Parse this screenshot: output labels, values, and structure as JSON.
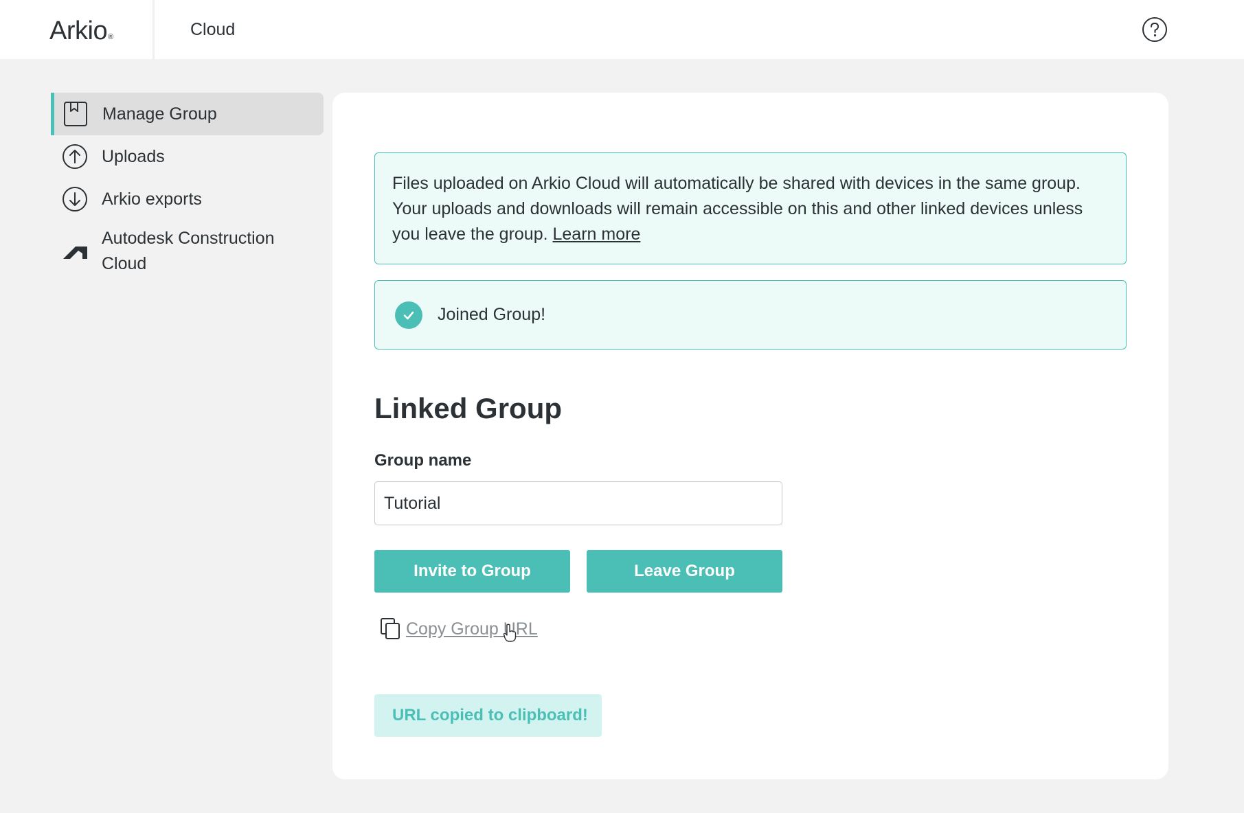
{
  "header": {
    "logo": "Arkio",
    "logo_mark": "®",
    "title": "Cloud",
    "help_icon": "help-circle-icon"
  },
  "sidebar": {
    "items": [
      {
        "label": "Manage Group",
        "icon": "bookmark-page-icon",
        "active": true
      },
      {
        "label": "Uploads",
        "icon": "upload-circle-icon",
        "active": false
      },
      {
        "label": "Arkio exports",
        "icon": "download-circle-icon",
        "active": false
      },
      {
        "label": "Autodesk Construction Cloud",
        "icon": "autodesk-logo-icon",
        "active": false
      }
    ]
  },
  "main": {
    "notice": {
      "text": "Files uploaded on Arkio Cloud will automatically be shared with devices in the same group. Your uploads and downloads will remain accessible on this and other linked devices unless you leave the group. ",
      "link": "Learn more"
    },
    "success": {
      "text": "Joined Group!",
      "icon": "check-circle-icon"
    },
    "section_title": "Linked Group",
    "group_name_label": "Group name",
    "group_name_value": "Tutorial",
    "invite_button": "Invite to Group",
    "leave_button": "Leave Group",
    "copy_url_link": "Copy Group URL",
    "copy_icon": "copy-icon",
    "toast": "URL copied to clipboard!"
  },
  "colors": {
    "accent": "#4bbfb5",
    "notice_bg": "#ecfbf8",
    "toast_bg": "#d2f3f0",
    "page_bg": "#f2f2f2",
    "text": "#2b3135"
  }
}
